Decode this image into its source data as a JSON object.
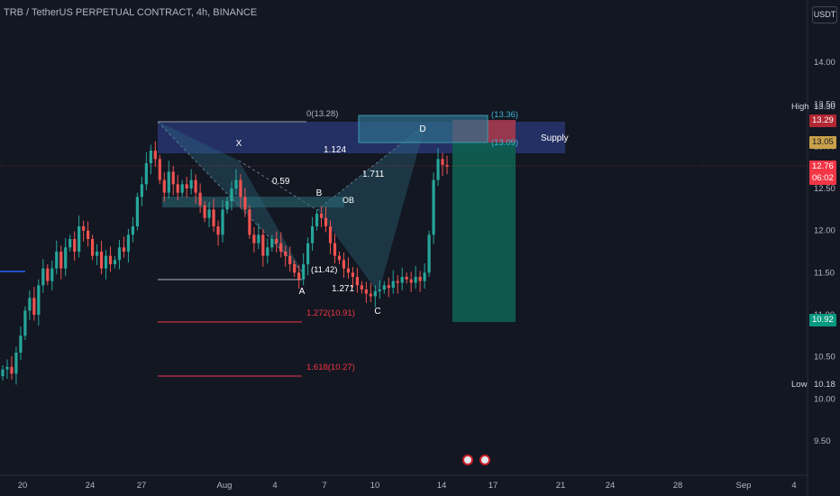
{
  "header": {
    "title": "TRB / TetherUS PERPETUAL CONTRACT, 4h, BINANCE",
    "currency": "USDT"
  },
  "price_scale": {
    "ticks": [
      "14.00",
      "13.50",
      "13.00",
      "12.50",
      "12.00",
      "11.50",
      "11.00",
      "10.50",
      "10.00",
      "9.50"
    ],
    "high_label": "High",
    "high_value": "13.30",
    "low_label": "Low",
    "low_value": "10.18",
    "tag_red": "13.29",
    "tag_orange": "13.05",
    "current_price": "12.76",
    "countdown": "06:02",
    "tag_teal": "10.92"
  },
  "time_axis": {
    "labels": [
      "20",
      "24",
      "27",
      "Aug",
      "4",
      "7",
      "10",
      "14",
      "17",
      "21",
      "24",
      "28",
      "Sep",
      "4"
    ]
  },
  "annotations": {
    "fib_0": "0(13.28)",
    "fib_1272": "1.272(10.91)",
    "fib_1618": "1.618(10.27)",
    "ratio_xab": "0.59",
    "ratio_xd": "1.124",
    "ratio_bcd": "1.711",
    "ratio_abc": "1.271",
    "point_x": "X",
    "point_a": "A",
    "point_b": "B",
    "point_c": "C",
    "point_d": "D",
    "a_price": "(11.42)",
    "ob": "OB",
    "supply": "Supply",
    "pos_top": "(13.36)",
    "pos_entry": "(13.09)"
  },
  "colors": {
    "background": "#131722",
    "up": "#26a69a",
    "down": "#ef5350",
    "supply_zone": "#2b3a7a",
    "pattern": "#2e6f86",
    "target_zone": "#0f5d4f",
    "stop_zone": "#ad3a4b"
  },
  "chart_data": {
    "type": "candlestick",
    "symbol": "TRB/USDT perpetual",
    "interval": "4h",
    "y_range": [
      9.2,
      14.5
    ],
    "levels": {
      "high": 13.3,
      "low": 10.18,
      "current": 12.76
    },
    "harmonic_pattern": {
      "X": 13.28,
      "A": 11.42,
      "B": 12.2,
      "C": 11.22,
      "D": 13.25
    },
    "fib_extensions": {
      "0": 13.28,
      "1.272": 10.91,
      "1.618": 10.27
    },
    "short_position": {
      "stop": 13.36,
      "entry": 13.09,
      "target": 10.92
    },
    "close_path": [
      10.35,
      10.38,
      10.3,
      10.55,
      10.75,
      11.05,
      11.2,
      11.0,
      11.35,
      11.55,
      11.4,
      11.55,
      11.75,
      11.55,
      11.8,
      11.9,
      11.75,
      12.05,
      12.0,
      11.9,
      11.7,
      11.75,
      11.55,
      11.7,
      11.6,
      11.65,
      11.8,
      11.75,
      11.95,
      12.05,
      12.4,
      12.55,
      12.8,
      12.95,
      12.85,
      12.6,
      12.45,
      12.7,
      12.55,
      12.45,
      12.55,
      12.5,
      12.6,
      12.45,
      12.3,
      12.15,
      12.25,
      12.05,
      11.95,
      12.25,
      12.35,
      12.5,
      12.6,
      12.4,
      12.25,
      11.95,
      11.85,
      11.95,
      11.7,
      11.8,
      11.9,
      11.85,
      11.75,
      11.7,
      11.6,
      11.5,
      11.42,
      11.6,
      11.85,
      12.05,
      12.2,
      12.15,
      12.05,
      11.85,
      11.7,
      11.65,
      11.55,
      11.5,
      11.45,
      11.35,
      11.3,
      11.25,
      11.22,
      11.28,
      11.3,
      11.35,
      11.32,
      11.4,
      11.38,
      11.45,
      11.42,
      11.38,
      11.45,
      11.4,
      11.5,
      11.95,
      12.6,
      12.85,
      12.78,
      12.76
    ]
  }
}
